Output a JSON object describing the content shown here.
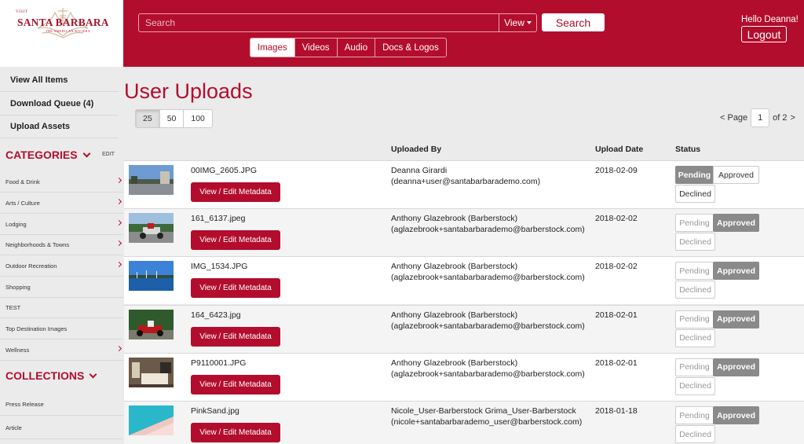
{
  "brand": {
    "visit": "VISIT",
    "title": "SANTA BARBARA",
    "tagline": "THE AMERICAN RIVIERA",
    "color": "#b30d2d"
  },
  "header": {
    "search_placeholder": "Search",
    "view_label": "View",
    "search_button": "Search",
    "greeting": "Hello Deanna!",
    "logout": "Logout",
    "media_tabs": [
      "Images",
      "Videos",
      "Audio",
      "Docs & Logos"
    ],
    "active_tab": "Images"
  },
  "sidebar": {
    "links": [
      "View All Items",
      "Download Queue (4)",
      "Upload Assets"
    ],
    "categories_heading": "CATEGORIES",
    "edit_label": "EDIT",
    "categories": [
      {
        "label": "Food & Drink",
        "has_children": true
      },
      {
        "label": "Arts / Culture",
        "has_children": true
      },
      {
        "label": "Lodging",
        "has_children": true
      },
      {
        "label": "Neighborhoods & Towns",
        "has_children": true
      },
      {
        "label": "Outdoor Recreation",
        "has_children": true
      },
      {
        "label": "Shopping",
        "has_children": false
      },
      {
        "label": "TEST",
        "has_children": false
      },
      {
        "label": "Top Destination Images",
        "has_children": false
      },
      {
        "label": "Wellness",
        "has_children": true
      }
    ],
    "collections_heading": "COLLECTIONS",
    "collections": [
      "Press Release",
      "Article"
    ]
  },
  "main": {
    "title": "User Uploads",
    "per_page_options": [
      "25",
      "50",
      "100"
    ],
    "per_page_selected": "25",
    "pager": {
      "prev": "< Page",
      "current": "1",
      "of": "of 2",
      "next": ">"
    },
    "columns": {
      "uploaded_by": "Uploaded By",
      "upload_date": "Upload Date",
      "status": "Status"
    },
    "action_label": "View / Edit Metadata",
    "status_labels": {
      "pending": "Pending",
      "approved": "Approved",
      "declined": "Declined"
    },
    "rows": [
      {
        "file": "00IMG_2605.JPG",
        "uploader": "Deanna Girardi",
        "email": "(deanna+user@santabarbarademo.com)",
        "date": "2018-02-09",
        "status": "pending",
        "thumb": "street"
      },
      {
        "file": "161_6137.jpeg",
        "uploader": "Anthony Glazebrook (Barberstock)",
        "email": "(aglazebrook+santabarbarademo@barberstock.com)",
        "date": "2018-02-02",
        "status": "approved",
        "thumb": "racecar"
      },
      {
        "file": "IMG_1534.JPG",
        "uploader": "Anthony Glazebrook (Barberstock)",
        "email": "(aglazebrook+santabarbarademo@barberstock.com)",
        "date": "2018-02-02",
        "status": "approved",
        "thumb": "harbor"
      },
      {
        "file": "164_6423.jpg",
        "uploader": "Anthony Glazebrook (Barberstock)",
        "email": "(aglazebrook+santabarbarademo@barberstock.com)",
        "date": "2018-02-01",
        "status": "approved",
        "thumb": "racecar2"
      },
      {
        "file": "P9110001.JPG",
        "uploader": "Anthony Glazebrook (Barberstock)",
        "email": "(aglazebrook+santabarbarademo@barberstock.com)",
        "date": "2018-02-01",
        "status": "approved",
        "thumb": "bedroom"
      },
      {
        "file": "PinkSand.jpg",
        "uploader": "Nicole_User-Barberstock Grima_User-Barberstock",
        "email": "(nicole+santabarbarademo_user@barberstock.com)",
        "date": "2018-01-18",
        "status": "approved",
        "thumb": "beach"
      }
    ]
  }
}
